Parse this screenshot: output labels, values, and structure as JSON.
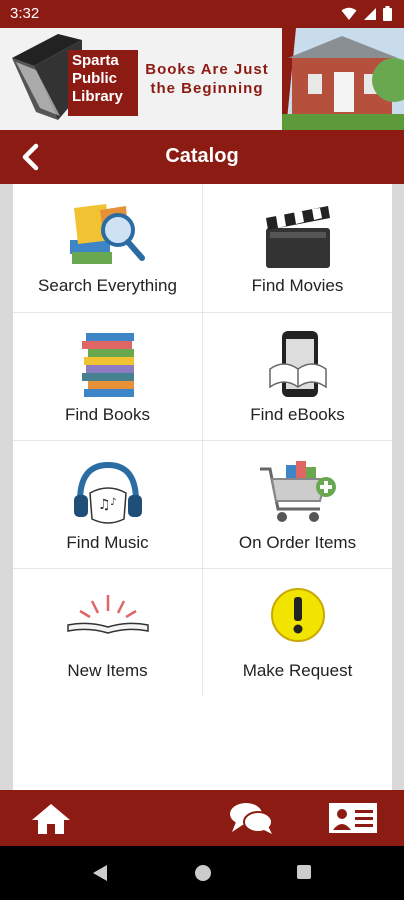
{
  "status_bar": {
    "time": "3:32",
    "icons": [
      "wifi-icon",
      "signal-icon",
      "battery-icon"
    ]
  },
  "banner": {
    "logo_lines": [
      "Sparta",
      "Public",
      "Library"
    ],
    "tagline_line1": "Books Are Just",
    "tagline_line2": "the Beginning"
  },
  "header": {
    "title": "Catalog",
    "back_icon": "chevron-left-icon"
  },
  "tiles": [
    {
      "label": "Search Everything",
      "icon": "search-everything-icon"
    },
    {
      "label": "Find Movies",
      "icon": "clapperboard-icon"
    },
    {
      "label": "Find Books",
      "icon": "book-stack-icon"
    },
    {
      "label": "Find eBooks",
      "icon": "ebook-device-icon"
    },
    {
      "label": "Find Music",
      "icon": "headphones-music-icon"
    },
    {
      "label": "On Order Items",
      "icon": "shopping-cart-add-icon"
    },
    {
      "label": "New Items",
      "icon": "open-book-sparkle-icon"
    },
    {
      "label": "Make Request",
      "icon": "exclamation-circle-icon"
    }
  ],
  "bottom_bar": {
    "items": [
      "home-icon",
      "chat-bubbles-icon",
      "contact-card-icon"
    ]
  },
  "android_nav": {
    "items": [
      "back-triangle-icon",
      "home-circle-icon",
      "recents-square-icon"
    ]
  },
  "colors": {
    "brand": "#8c1c13",
    "content_bg": "#ffffff",
    "frame_bg": "#d9d9d9"
  }
}
